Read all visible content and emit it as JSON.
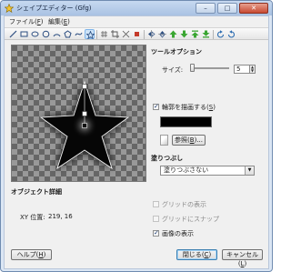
{
  "window": {
    "title": "シェイプエディター (Gfg)",
    "minimize": "–",
    "maximize": "□",
    "close": "✕"
  },
  "menu": {
    "file": "ファイル",
    "file_key": "F",
    "edit": "編集",
    "edit_key": "E"
  },
  "toolbar": {
    "icons": [
      "line-tool-icon",
      "rectangle-tool-icon",
      "ellipse-tool-icon",
      "circle-tool-icon",
      "arc-tool-icon",
      "polygon-tool-icon",
      "star-tool-icon",
      "grid-toggle-icon",
      "crop-tool-icon",
      "move-point-icon",
      "delete-point-icon",
      "flip-horizontal-icon",
      "flip-vertical-icon",
      "move-up-icon",
      "move-down-icon",
      "rotate-left-icon",
      "rotate-right-icon"
    ],
    "active": "star-tool-icon"
  },
  "tool_options": {
    "heading": "ツールオプション",
    "size_label": "サイズ:",
    "size_value": "5"
  },
  "outline": {
    "label": "輪郭を描画する",
    "key": "S",
    "checked": true,
    "color": "#000000",
    "browse_label": "参照",
    "browse_key": "B"
  },
  "fill": {
    "heading": "塗りつぶし",
    "selected": "塗りつぶさない"
  },
  "object_details": {
    "heading": "オブジェクト詳細",
    "xy_label": "XY 位置:",
    "xy_value": "219, 16"
  },
  "view": {
    "show_grid": {
      "label": "グリッドの表示",
      "checked": false
    },
    "snap_to_grid": {
      "label": "グリッドにスナップ",
      "checked": false
    },
    "show_image": {
      "label": "画像の表示",
      "checked": true
    }
  },
  "buttons": {
    "help": "ヘルプ",
    "help_key": "H",
    "ok": "閉じる",
    "ok_key": "C",
    "cancel": "キャンセル",
    "cancel_key": "L"
  }
}
